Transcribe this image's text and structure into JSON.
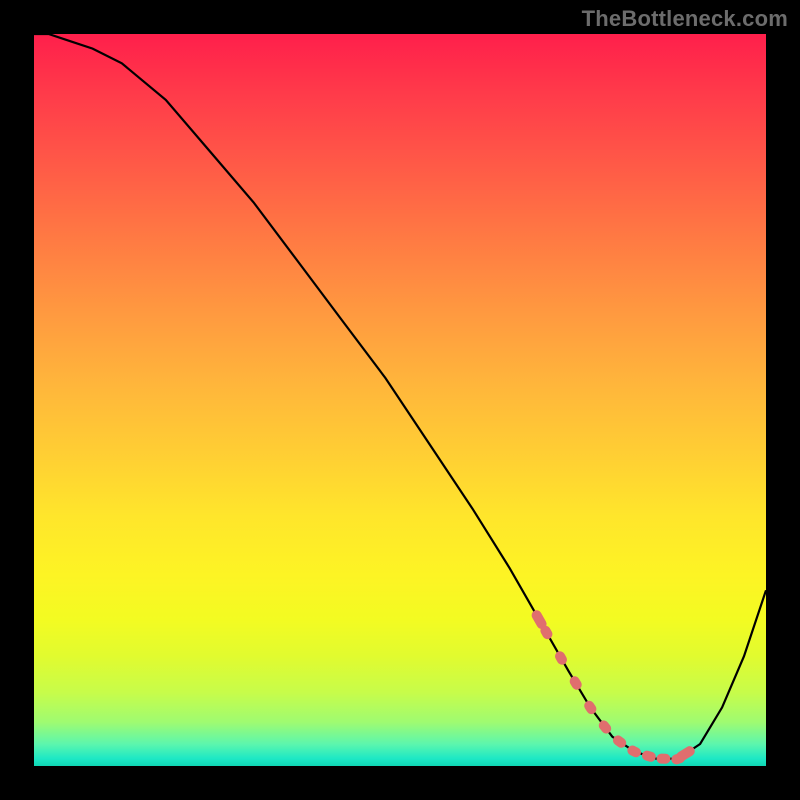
{
  "attribution": "TheBottleneck.com",
  "chart_data": {
    "type": "line",
    "title": "",
    "xlabel": "",
    "ylabel": "",
    "xlim": [
      0,
      100
    ],
    "ylim": [
      0,
      100
    ],
    "x": [
      0,
      2,
      5,
      8,
      12,
      18,
      24,
      30,
      36,
      42,
      48,
      54,
      60,
      65,
      69,
      73,
      76,
      79,
      82,
      85,
      88,
      91,
      94,
      97,
      100
    ],
    "values": [
      100,
      100,
      99,
      98,
      96,
      91,
      84,
      77,
      69,
      61,
      53,
      44,
      35,
      27,
      20,
      13,
      8,
      4,
      2,
      1,
      1,
      3,
      8,
      15,
      24
    ],
    "marker_band_y": [
      0,
      6
    ],
    "markers_x": [
      69,
      70,
      72,
      74,
      76,
      78,
      80,
      82,
      84,
      86,
      88,
      89
    ],
    "marker_color": "#e06e6e",
    "line_color": "#000000"
  }
}
